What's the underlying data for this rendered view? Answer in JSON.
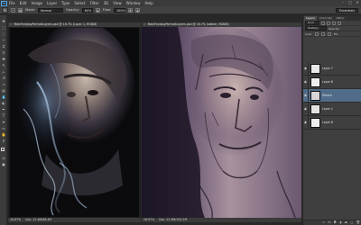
{
  "app": {
    "logo": "Ps"
  },
  "menu": [
    "File",
    "Edit",
    "Image",
    "Layer",
    "Type",
    "Select",
    "Filter",
    "3D",
    "View",
    "Window",
    "Help"
  ],
  "window_controls": {
    "minimize": "–",
    "maximize": "□",
    "close": "✕"
  },
  "options": {
    "mode_label": "Mode:",
    "mode_value": "Normal",
    "opacity_label": "Opacity:",
    "opacity_value": "60%",
    "flow_label": "Flow:",
    "flow_value": "100%",
    "workspace": "Essentials"
  },
  "docs": {
    "left": {
      "title": "MaleFantasyPortraitLayers.psd @ 16.7% (Layer 1, RGB/8)",
      "zoom": "16.67%",
      "doc_info": "Doc: 22.6M/88.4M"
    },
    "right": {
      "title": "MaleFantasyPortraitLayers.psd @ 16.7% (sketch, RGB/8)",
      "zoom": "16.67%",
      "doc_info": "Doc: 22.6M/100.2M"
    }
  },
  "panel": {
    "tabs": [
      "Layers",
      "Channels",
      "Paths"
    ],
    "kind_label": "Kind",
    "blend_mode": "Multiply",
    "opacity_label": "Opacity:",
    "lock_label": "Lock:",
    "fill_label": "Fill:",
    "layers": [
      {
        "name": "Layer 7"
      },
      {
        "name": "Layer 8"
      },
      {
        "name": "Sketch"
      },
      {
        "name": "Layer 1"
      },
      {
        "name": "Layer 6"
      }
    ],
    "footer_icons": [
      "link-icon",
      "fx-icon",
      "mask-icon",
      "adjustment-icon",
      "folder-icon",
      "new-layer-icon",
      "trash-icon"
    ]
  },
  "colors": {
    "accent": "#4ea3e6",
    "selection": "#516c89",
    "panel_bg": "#3f3f3f",
    "workspace_bg": "#1e1e1e"
  }
}
